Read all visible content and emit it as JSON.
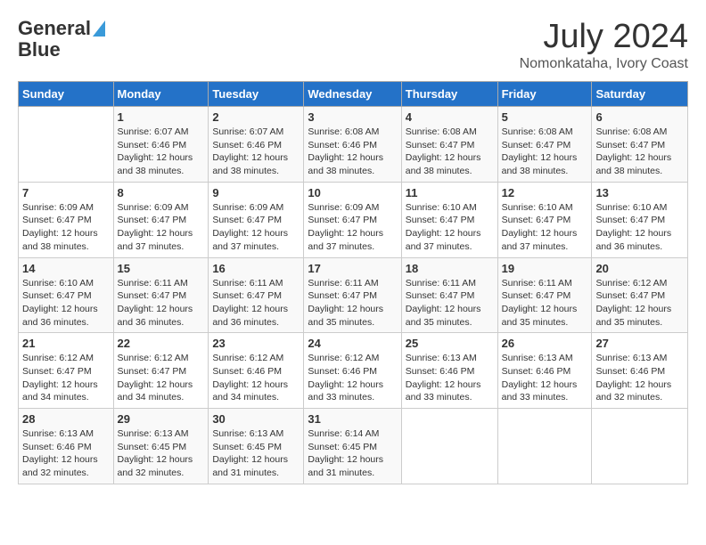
{
  "logo": {
    "line1": "General",
    "line2": "Blue"
  },
  "title": "July 2024",
  "subtitle": "Nomonkataha, Ivory Coast",
  "days_header": [
    "Sunday",
    "Monday",
    "Tuesday",
    "Wednesday",
    "Thursday",
    "Friday",
    "Saturday"
  ],
  "weeks": [
    [
      {
        "day": "",
        "info": ""
      },
      {
        "day": "1",
        "info": "Sunrise: 6:07 AM\nSunset: 6:46 PM\nDaylight: 12 hours\nand 38 minutes."
      },
      {
        "day": "2",
        "info": "Sunrise: 6:07 AM\nSunset: 6:46 PM\nDaylight: 12 hours\nand 38 minutes."
      },
      {
        "day": "3",
        "info": "Sunrise: 6:08 AM\nSunset: 6:46 PM\nDaylight: 12 hours\nand 38 minutes."
      },
      {
        "day": "4",
        "info": "Sunrise: 6:08 AM\nSunset: 6:47 PM\nDaylight: 12 hours\nand 38 minutes."
      },
      {
        "day": "5",
        "info": "Sunrise: 6:08 AM\nSunset: 6:47 PM\nDaylight: 12 hours\nand 38 minutes."
      },
      {
        "day": "6",
        "info": "Sunrise: 6:08 AM\nSunset: 6:47 PM\nDaylight: 12 hours\nand 38 minutes."
      }
    ],
    [
      {
        "day": "7",
        "info": "Sunrise: 6:09 AM\nSunset: 6:47 PM\nDaylight: 12 hours\nand 38 minutes."
      },
      {
        "day": "8",
        "info": "Sunrise: 6:09 AM\nSunset: 6:47 PM\nDaylight: 12 hours\nand 37 minutes."
      },
      {
        "day": "9",
        "info": "Sunrise: 6:09 AM\nSunset: 6:47 PM\nDaylight: 12 hours\nand 37 minutes."
      },
      {
        "day": "10",
        "info": "Sunrise: 6:09 AM\nSunset: 6:47 PM\nDaylight: 12 hours\nand 37 minutes."
      },
      {
        "day": "11",
        "info": "Sunrise: 6:10 AM\nSunset: 6:47 PM\nDaylight: 12 hours\nand 37 minutes."
      },
      {
        "day": "12",
        "info": "Sunrise: 6:10 AM\nSunset: 6:47 PM\nDaylight: 12 hours\nand 37 minutes."
      },
      {
        "day": "13",
        "info": "Sunrise: 6:10 AM\nSunset: 6:47 PM\nDaylight: 12 hours\nand 36 minutes."
      }
    ],
    [
      {
        "day": "14",
        "info": "Sunrise: 6:10 AM\nSunset: 6:47 PM\nDaylight: 12 hours\nand 36 minutes."
      },
      {
        "day": "15",
        "info": "Sunrise: 6:11 AM\nSunset: 6:47 PM\nDaylight: 12 hours\nand 36 minutes."
      },
      {
        "day": "16",
        "info": "Sunrise: 6:11 AM\nSunset: 6:47 PM\nDaylight: 12 hours\nand 36 minutes."
      },
      {
        "day": "17",
        "info": "Sunrise: 6:11 AM\nSunset: 6:47 PM\nDaylight: 12 hours\nand 35 minutes."
      },
      {
        "day": "18",
        "info": "Sunrise: 6:11 AM\nSunset: 6:47 PM\nDaylight: 12 hours\nand 35 minutes."
      },
      {
        "day": "19",
        "info": "Sunrise: 6:11 AM\nSunset: 6:47 PM\nDaylight: 12 hours\nand 35 minutes."
      },
      {
        "day": "20",
        "info": "Sunrise: 6:12 AM\nSunset: 6:47 PM\nDaylight: 12 hours\nand 35 minutes."
      }
    ],
    [
      {
        "day": "21",
        "info": "Sunrise: 6:12 AM\nSunset: 6:47 PM\nDaylight: 12 hours\nand 34 minutes."
      },
      {
        "day": "22",
        "info": "Sunrise: 6:12 AM\nSunset: 6:47 PM\nDaylight: 12 hours\nand 34 minutes."
      },
      {
        "day": "23",
        "info": "Sunrise: 6:12 AM\nSunset: 6:46 PM\nDaylight: 12 hours\nand 34 minutes."
      },
      {
        "day": "24",
        "info": "Sunrise: 6:12 AM\nSunset: 6:46 PM\nDaylight: 12 hours\nand 33 minutes."
      },
      {
        "day": "25",
        "info": "Sunrise: 6:13 AM\nSunset: 6:46 PM\nDaylight: 12 hours\nand 33 minutes."
      },
      {
        "day": "26",
        "info": "Sunrise: 6:13 AM\nSunset: 6:46 PM\nDaylight: 12 hours\nand 33 minutes."
      },
      {
        "day": "27",
        "info": "Sunrise: 6:13 AM\nSunset: 6:46 PM\nDaylight: 12 hours\nand 32 minutes."
      }
    ],
    [
      {
        "day": "28",
        "info": "Sunrise: 6:13 AM\nSunset: 6:46 PM\nDaylight: 12 hours\nand 32 minutes."
      },
      {
        "day": "29",
        "info": "Sunrise: 6:13 AM\nSunset: 6:45 PM\nDaylight: 12 hours\nand 32 minutes."
      },
      {
        "day": "30",
        "info": "Sunrise: 6:13 AM\nSunset: 6:45 PM\nDaylight: 12 hours\nand 31 minutes."
      },
      {
        "day": "31",
        "info": "Sunrise: 6:14 AM\nSunset: 6:45 PM\nDaylight: 12 hours\nand 31 minutes."
      },
      {
        "day": "",
        "info": ""
      },
      {
        "day": "",
        "info": ""
      },
      {
        "day": "",
        "info": ""
      }
    ]
  ]
}
